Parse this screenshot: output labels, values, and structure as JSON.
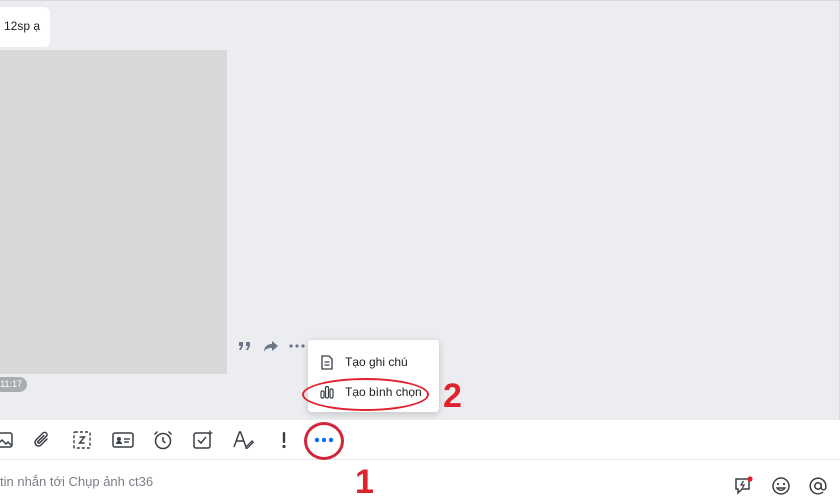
{
  "chat": {
    "message_text": "12sp ạ",
    "time": "11:17"
  },
  "more_menu": {
    "items": [
      {
        "label": "Tạo ghi chú",
        "icon": "note-icon"
      },
      {
        "label": "Tạo bình chọn",
        "icon": "poll-icon"
      }
    ]
  },
  "annotations": {
    "step_one": "1",
    "step_two": "2"
  },
  "toolbar": {
    "icons": [
      "image-icon",
      "attachment-icon",
      "screenshot-icon",
      "contact-card-icon",
      "reminder-icon",
      "task-icon",
      "text-format-icon",
      "urgent-icon",
      "more-icon"
    ]
  },
  "composer": {
    "placeholder": "tin nhắn tới Chụp ảnh ct36",
    "right_icons": [
      "quick-message-icon",
      "emoji-icon",
      "mention-icon"
    ]
  },
  "colors": {
    "accent": "#0068ff",
    "highlight_red": "#e0222e",
    "chat_bg": "#ebedf0"
  }
}
